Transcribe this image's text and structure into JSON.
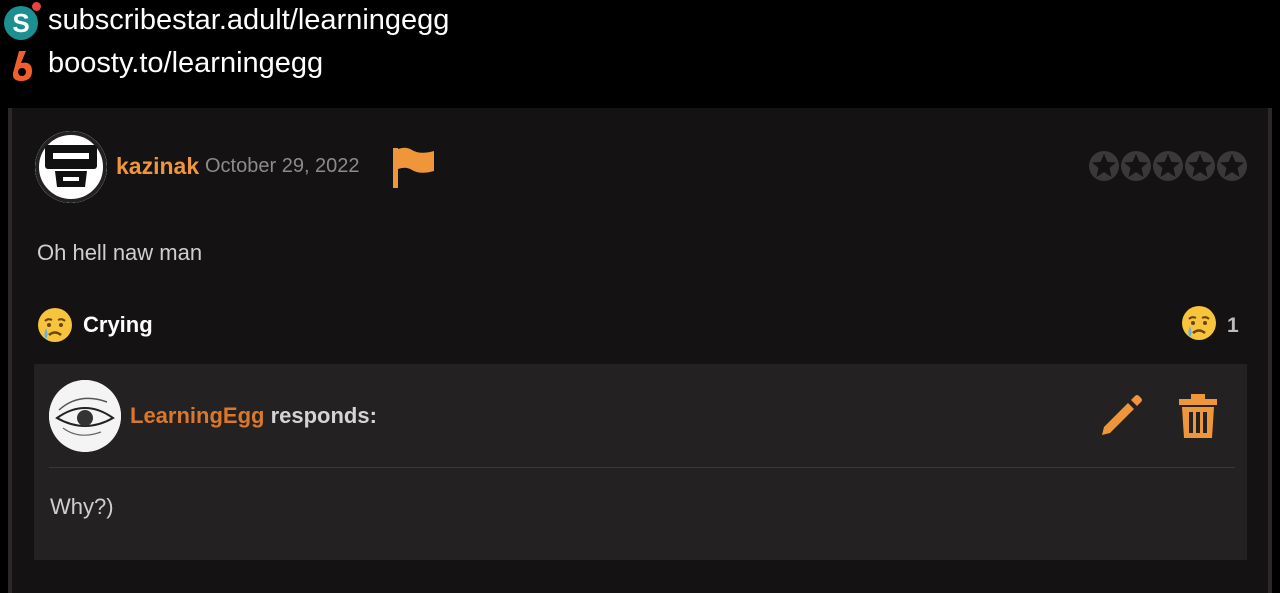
{
  "overlay": {
    "line1": "subscribestar.adult/learningegg",
    "line2": "boosty.to/learningegg",
    "icon1": "subscribestar-icon",
    "icon2": "boosty-icon"
  },
  "comment": {
    "username": "kazinak",
    "date": "October 29, 2022",
    "text": "Oh hell naw man",
    "rating": {
      "filled": 0,
      "max": 5
    },
    "reaction": {
      "label": "Crying",
      "count": "1",
      "icon": "crying-emoji-icon"
    }
  },
  "response": {
    "author": "LearningEgg",
    "suffix": "responds:",
    "text": "Why?)"
  },
  "colors": {
    "accent": "#f0963a",
    "author": "#d9782d",
    "panel": "#141212",
    "response_bg": "#232121"
  }
}
